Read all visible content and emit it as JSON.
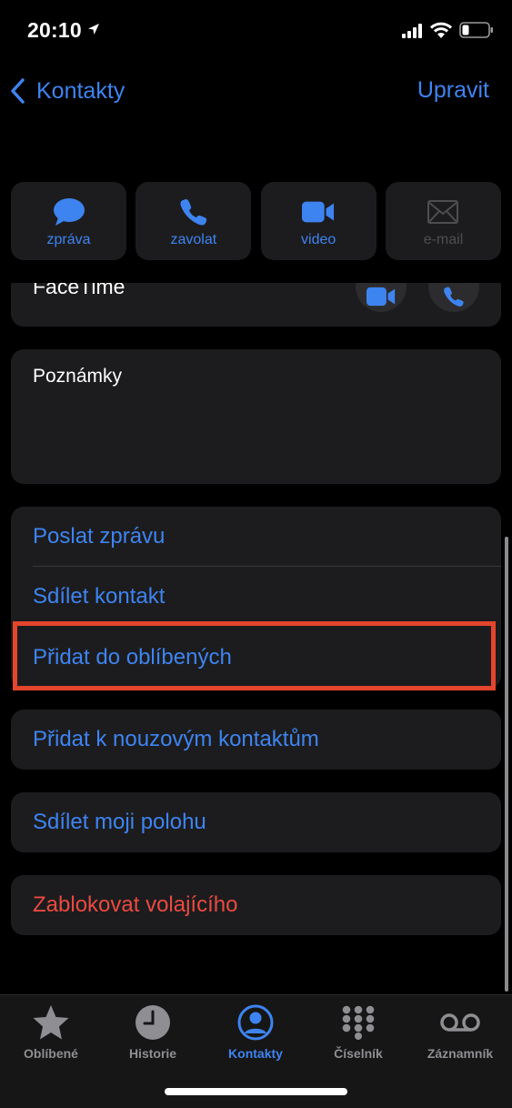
{
  "status_bar": {
    "time": "20:10"
  },
  "nav": {
    "back_label": "Kontakty",
    "edit_label": "Upravit"
  },
  "actions": [
    {
      "label": "zpráva",
      "icon": "message-icon",
      "enabled": true
    },
    {
      "label": "zavolat",
      "icon": "phone-icon",
      "enabled": true
    },
    {
      "label": "video",
      "icon": "video-icon",
      "enabled": true
    },
    {
      "label": "e-mail",
      "icon": "mail-icon",
      "enabled": false
    }
  ],
  "facetime": {
    "label": "FaceTime"
  },
  "notes": {
    "label": "Poznámky"
  },
  "options_group": [
    {
      "label": "Poslat zprávu"
    },
    {
      "label": "Sdílet kontakt"
    },
    {
      "label": "Přidat do oblíbených",
      "highlighted": true
    }
  ],
  "options": {
    "emergency": "Přidat k nouzovým kontaktům",
    "share_location": "Sdílet moji polohu",
    "block": "Zablokovat volajícího"
  },
  "tabs": [
    {
      "label": "Oblíbené",
      "icon": "star-icon",
      "active": false
    },
    {
      "label": "Historie",
      "icon": "clock-icon",
      "active": false
    },
    {
      "label": "Kontakty",
      "icon": "person-circle-icon",
      "active": true
    },
    {
      "label": "Číselník",
      "icon": "keypad-icon",
      "active": false
    },
    {
      "label": "Záznamník",
      "icon": "voicemail-icon",
      "active": false
    }
  ],
  "colors": {
    "accent": "#3e84f0",
    "danger": "#eb4a40",
    "highlight": "#e4452d",
    "card": "#1c1c1e"
  }
}
